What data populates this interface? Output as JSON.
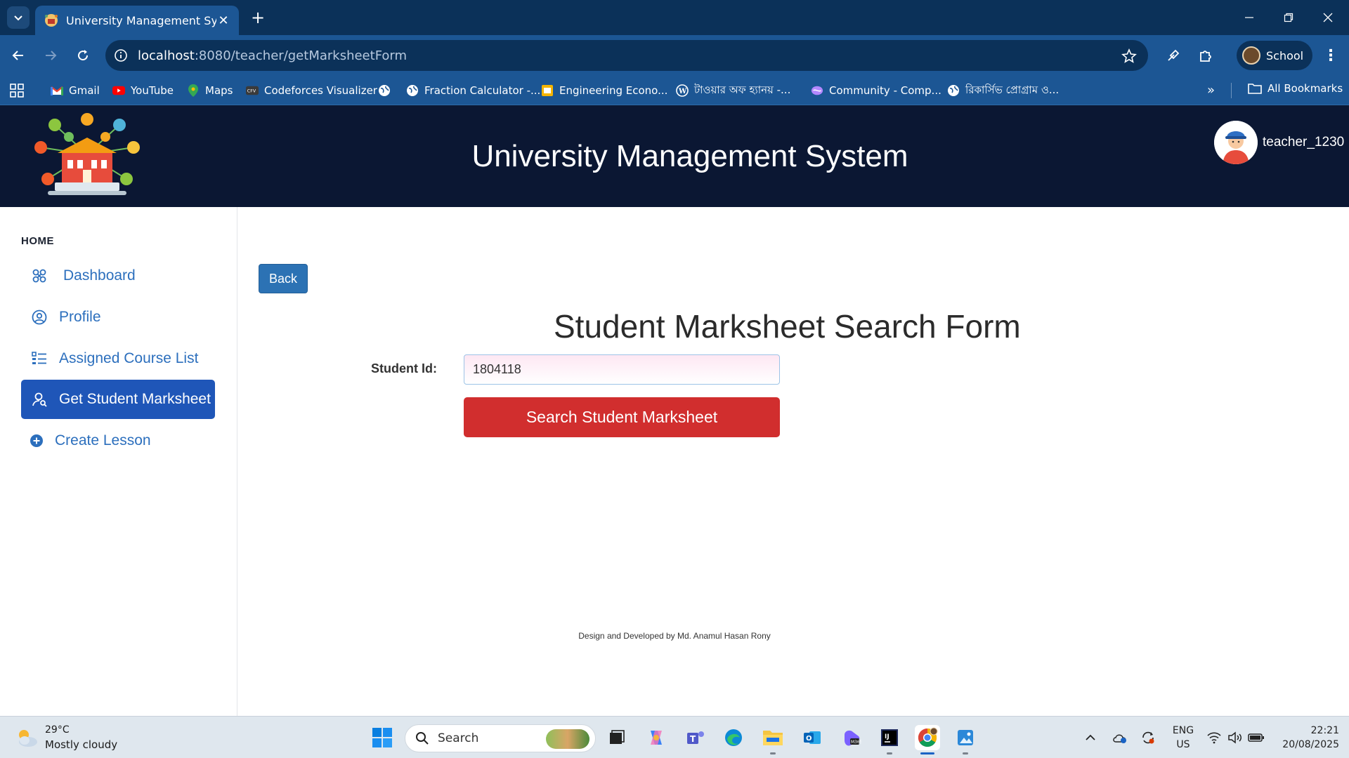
{
  "browser": {
    "tab_title": "University Management System",
    "url_host": "localhost",
    "url_path": ":8080/teacher/getMarksheetForm",
    "profile_name": "School",
    "bookmarks": [
      {
        "label": "Gmail",
        "icon": "gmail-icon"
      },
      {
        "label": "YouTube",
        "icon": "youtube-icon"
      },
      {
        "label": "Maps",
        "icon": "maps-icon"
      },
      {
        "label": "Codeforces Visualizer",
        "icon": "cfv-icon"
      },
      {
        "label": "",
        "icon": "globe-icon"
      },
      {
        "label": "Fraction Calculator -...",
        "icon": "globe-icon"
      },
      {
        "label": "Engineering Econo...",
        "icon": "slides-icon"
      },
      {
        "label": "টাওয়ার অফ হ্যানয় -...",
        "icon": "wordpress-icon"
      },
      {
        "label": "Community - Comp...",
        "icon": "community-icon"
      },
      {
        "label": "রিকার্সিভ প্রোগ্রাম ও...",
        "icon": "globe-icon"
      }
    ],
    "all_bookmarks_label": "All Bookmarks"
  },
  "header": {
    "title": "University Management System",
    "username": "teacher_1230"
  },
  "sidebar": {
    "heading": "HOME",
    "items": [
      {
        "label": "Dashboard",
        "icon": "dashboard-icon"
      },
      {
        "label": "Profile",
        "icon": "profile-icon"
      },
      {
        "label": "Assigned Course List",
        "icon": "list-icon"
      },
      {
        "label": "Get Student Marksheet",
        "icon": "user-search-icon"
      },
      {
        "label": "Create Lesson",
        "icon": "plus-circle-icon"
      }
    ],
    "active_index": 3
  },
  "main": {
    "back_label": "Back",
    "form_title": "Student Marksheet Search Form",
    "student_id_label": "Student Id:",
    "student_id_value": "1804118",
    "search_button_label": "Search Student Marksheet",
    "footer": "Design and Developed by Md. Anamul Hasan Rony"
  },
  "taskbar": {
    "weather_temp": "29°C",
    "weather_desc": "Mostly cloudy",
    "search_label": "Search",
    "lang_line1": "ENG",
    "lang_line2": "US",
    "time": "22:21",
    "date": "20/08/2025"
  },
  "colors": {
    "header_bg": "#0b1733",
    "active_nav": "#1f56b8",
    "search_button": "#d12e2e",
    "back_button": "#2c72b4",
    "nav_text": "#2c6fbd"
  }
}
